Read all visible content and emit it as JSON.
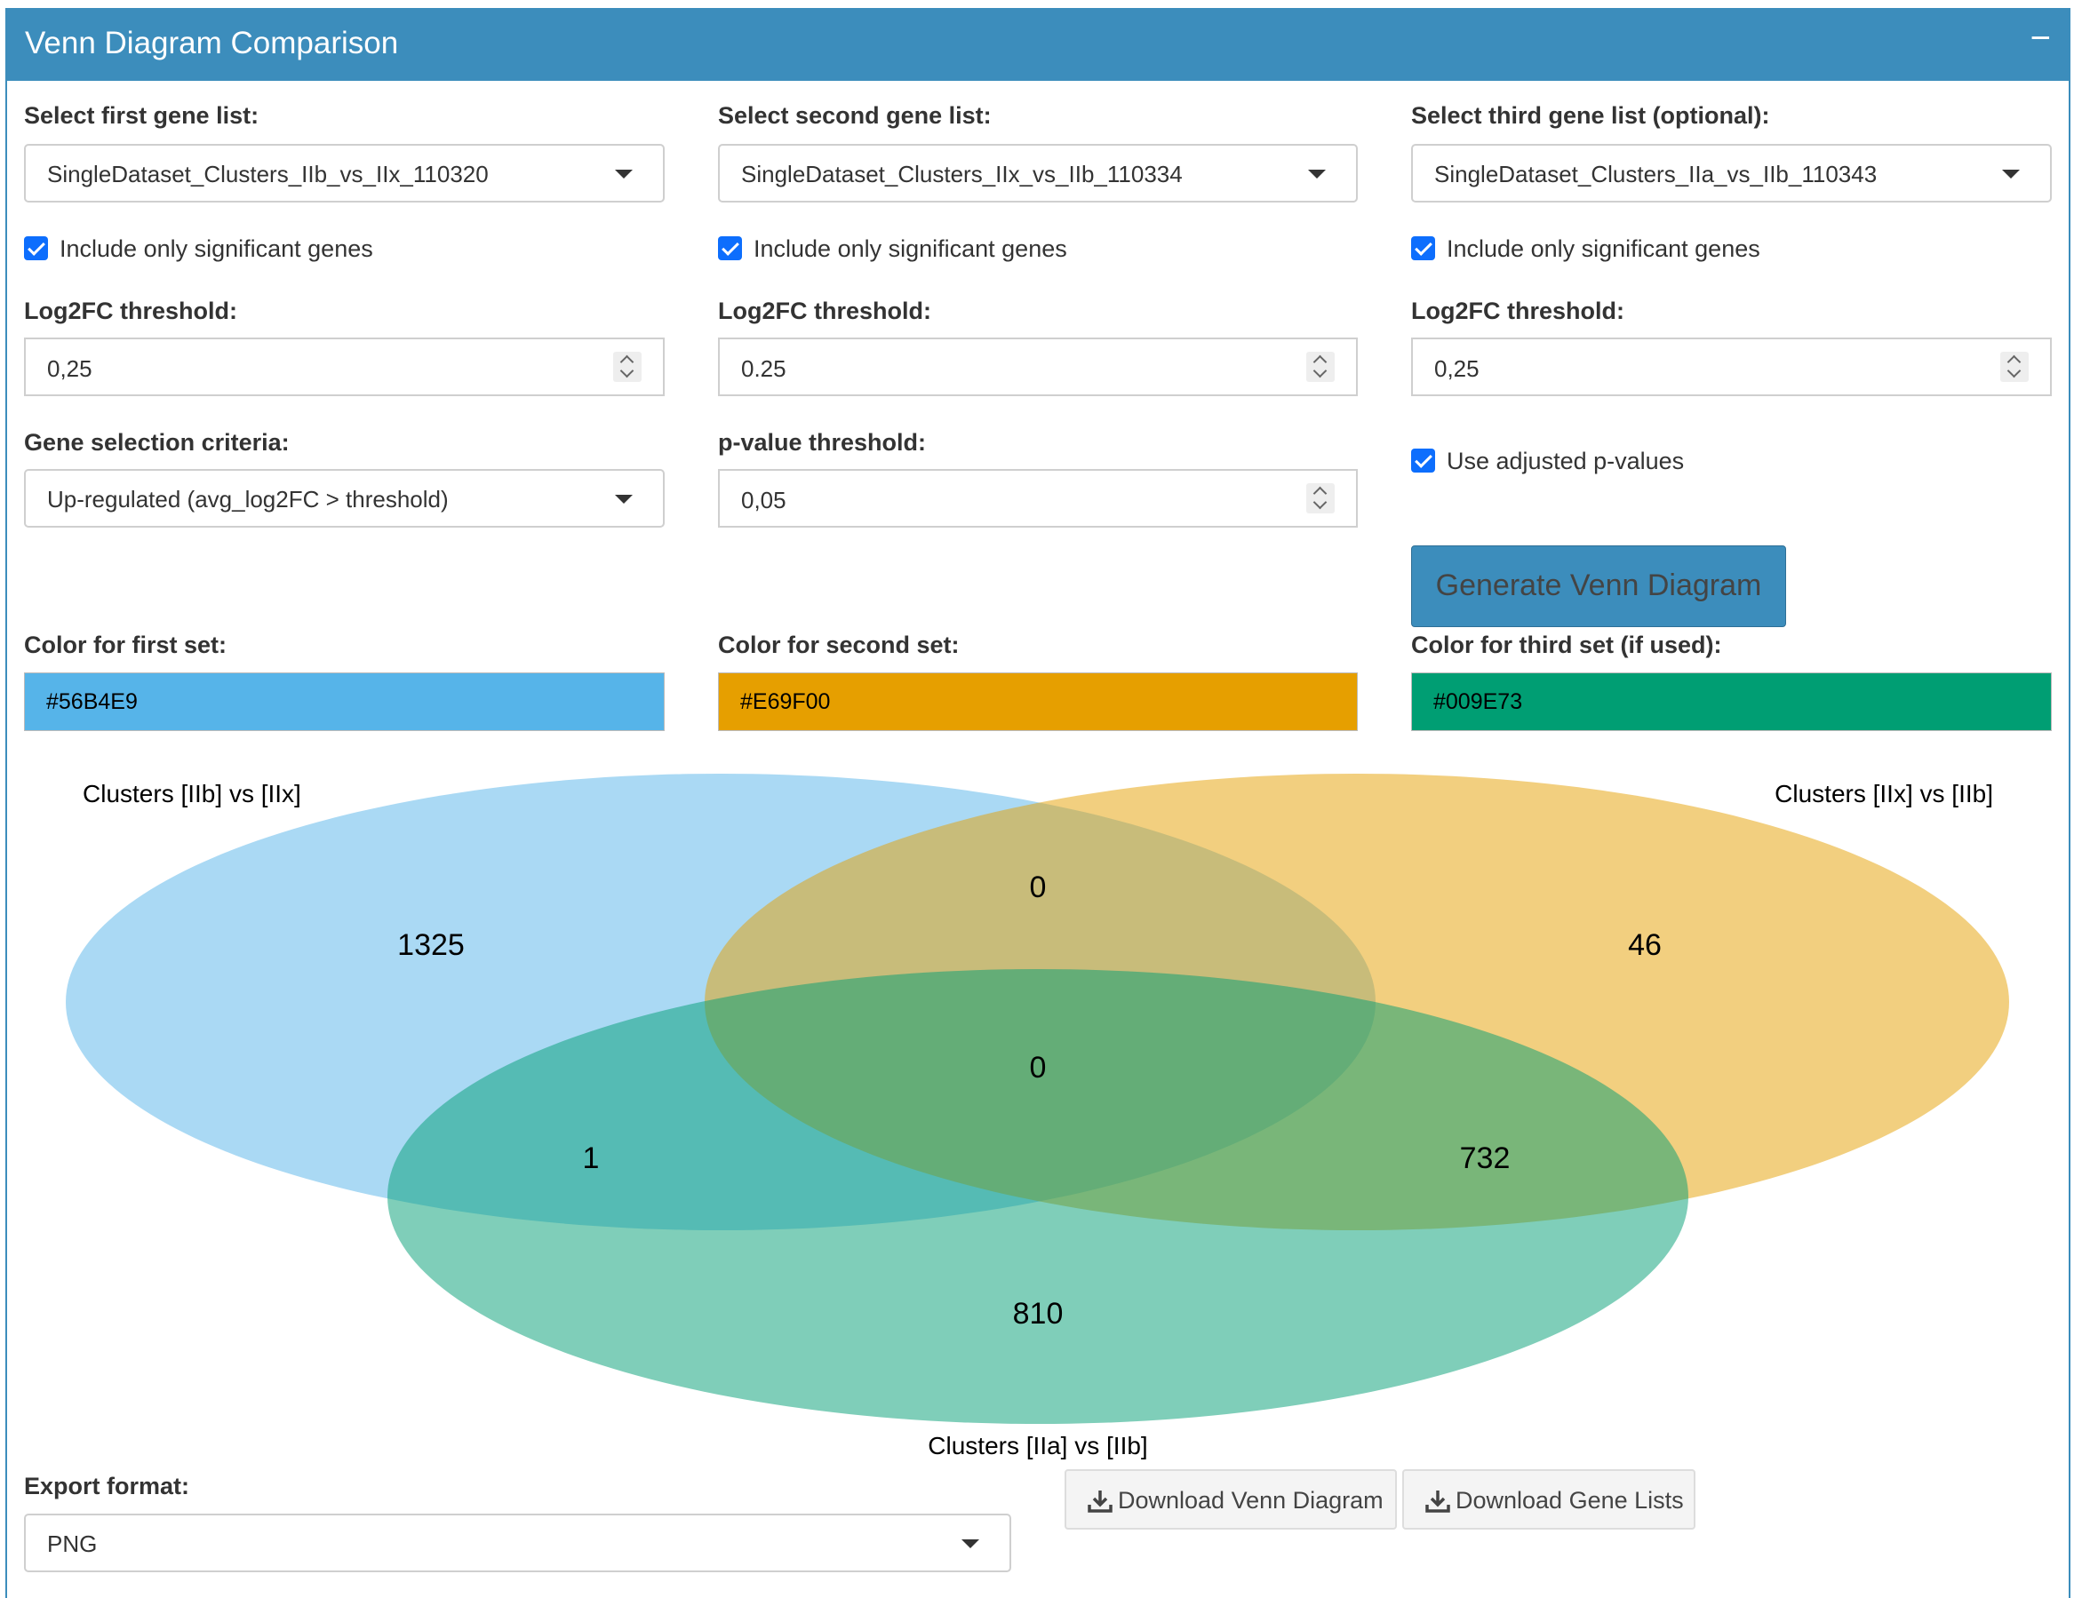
{
  "panel": {
    "title": "Venn Diagram Comparison",
    "collapse_symbol": "−"
  },
  "list1": {
    "label": "Select first gene list:",
    "value": "SingleDataset_Clusters_IIb_vs_IIx_110320",
    "sig_label": "Include only significant genes",
    "log2fc_label": "Log2FC threshold:",
    "log2fc_value": "0,25",
    "criteria_label": "Gene selection criteria:",
    "criteria_value": "Up-regulated (avg_log2FC > threshold)",
    "color_label": "Color for first set:",
    "color_value": "#56B4E9"
  },
  "list2": {
    "label": "Select second gene list:",
    "value": "SingleDataset_Clusters_IIx_vs_IIb_110334",
    "sig_label": "Include only significant genes",
    "log2fc_label": "Log2FC threshold:",
    "log2fc_value": "0.25",
    "pvalue_label": "p-value threshold:",
    "pvalue_value": "0,05",
    "color_label": "Color for second set:",
    "color_value": "#E69F00"
  },
  "list3": {
    "label": "Select third gene list (optional):",
    "value": "SingleDataset_Clusters_IIa_vs_IIb_110343",
    "sig_label": "Include only significant genes",
    "log2fc_label": "Log2FC threshold:",
    "log2fc_value": "0,25",
    "adjusted_label": "Use adjusted p-values",
    "color_label": "Color for third set (if used):",
    "color_value": "#009E73"
  },
  "generate_button": "Generate Venn Diagram",
  "venn": {
    "set_a": "Clusters [IIb] vs [IIx]",
    "set_b": "Clusters [IIx] vs [IIb]",
    "set_c": "Clusters [IIa] vs [IIb]",
    "a_only": "1325",
    "b_only": "46",
    "c_only": "810",
    "ab": "0",
    "ac": "1",
    "bc": "732",
    "abc": "0"
  },
  "export": {
    "label": "Export format:",
    "value": "PNG",
    "download_venn": "Download Venn Diagram",
    "download_lists": "Download Gene Lists"
  },
  "colors": {
    "header": "#3c8dbc",
    "checkbox": "#0d6efd"
  },
  "icons": {
    "download": "download-icon",
    "caret": "caret-down-icon"
  }
}
